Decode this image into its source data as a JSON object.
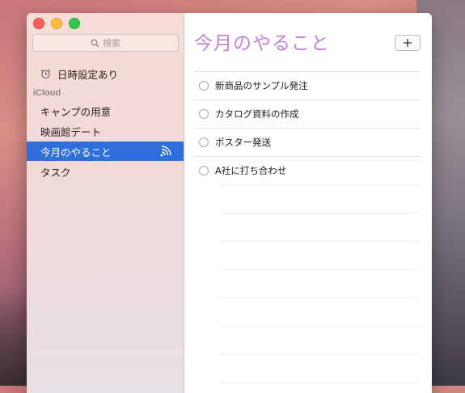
{
  "sidebar": {
    "search_placeholder": "検索",
    "scheduled_label": "日時設定あり",
    "section_header": "iCloud",
    "lists": [
      {
        "label": "キャンプの用意"
      },
      {
        "label": "映画館デート"
      },
      {
        "label": "今月のやること",
        "selected": true
      },
      {
        "label": "タスク"
      }
    ]
  },
  "main": {
    "title": "今月のやること",
    "add_button": "+",
    "reminders": [
      {
        "text": "新商品のサンプル発注",
        "completed": false
      },
      {
        "text": "カタログ資料の作成",
        "completed": false
      },
      {
        "text": "ポスター発送",
        "completed": false
      },
      {
        "text": "A社に打ち合わせ",
        "completed": false
      }
    ]
  },
  "colors": {
    "title": "#c580d9",
    "selection": "#2e6fdc"
  }
}
